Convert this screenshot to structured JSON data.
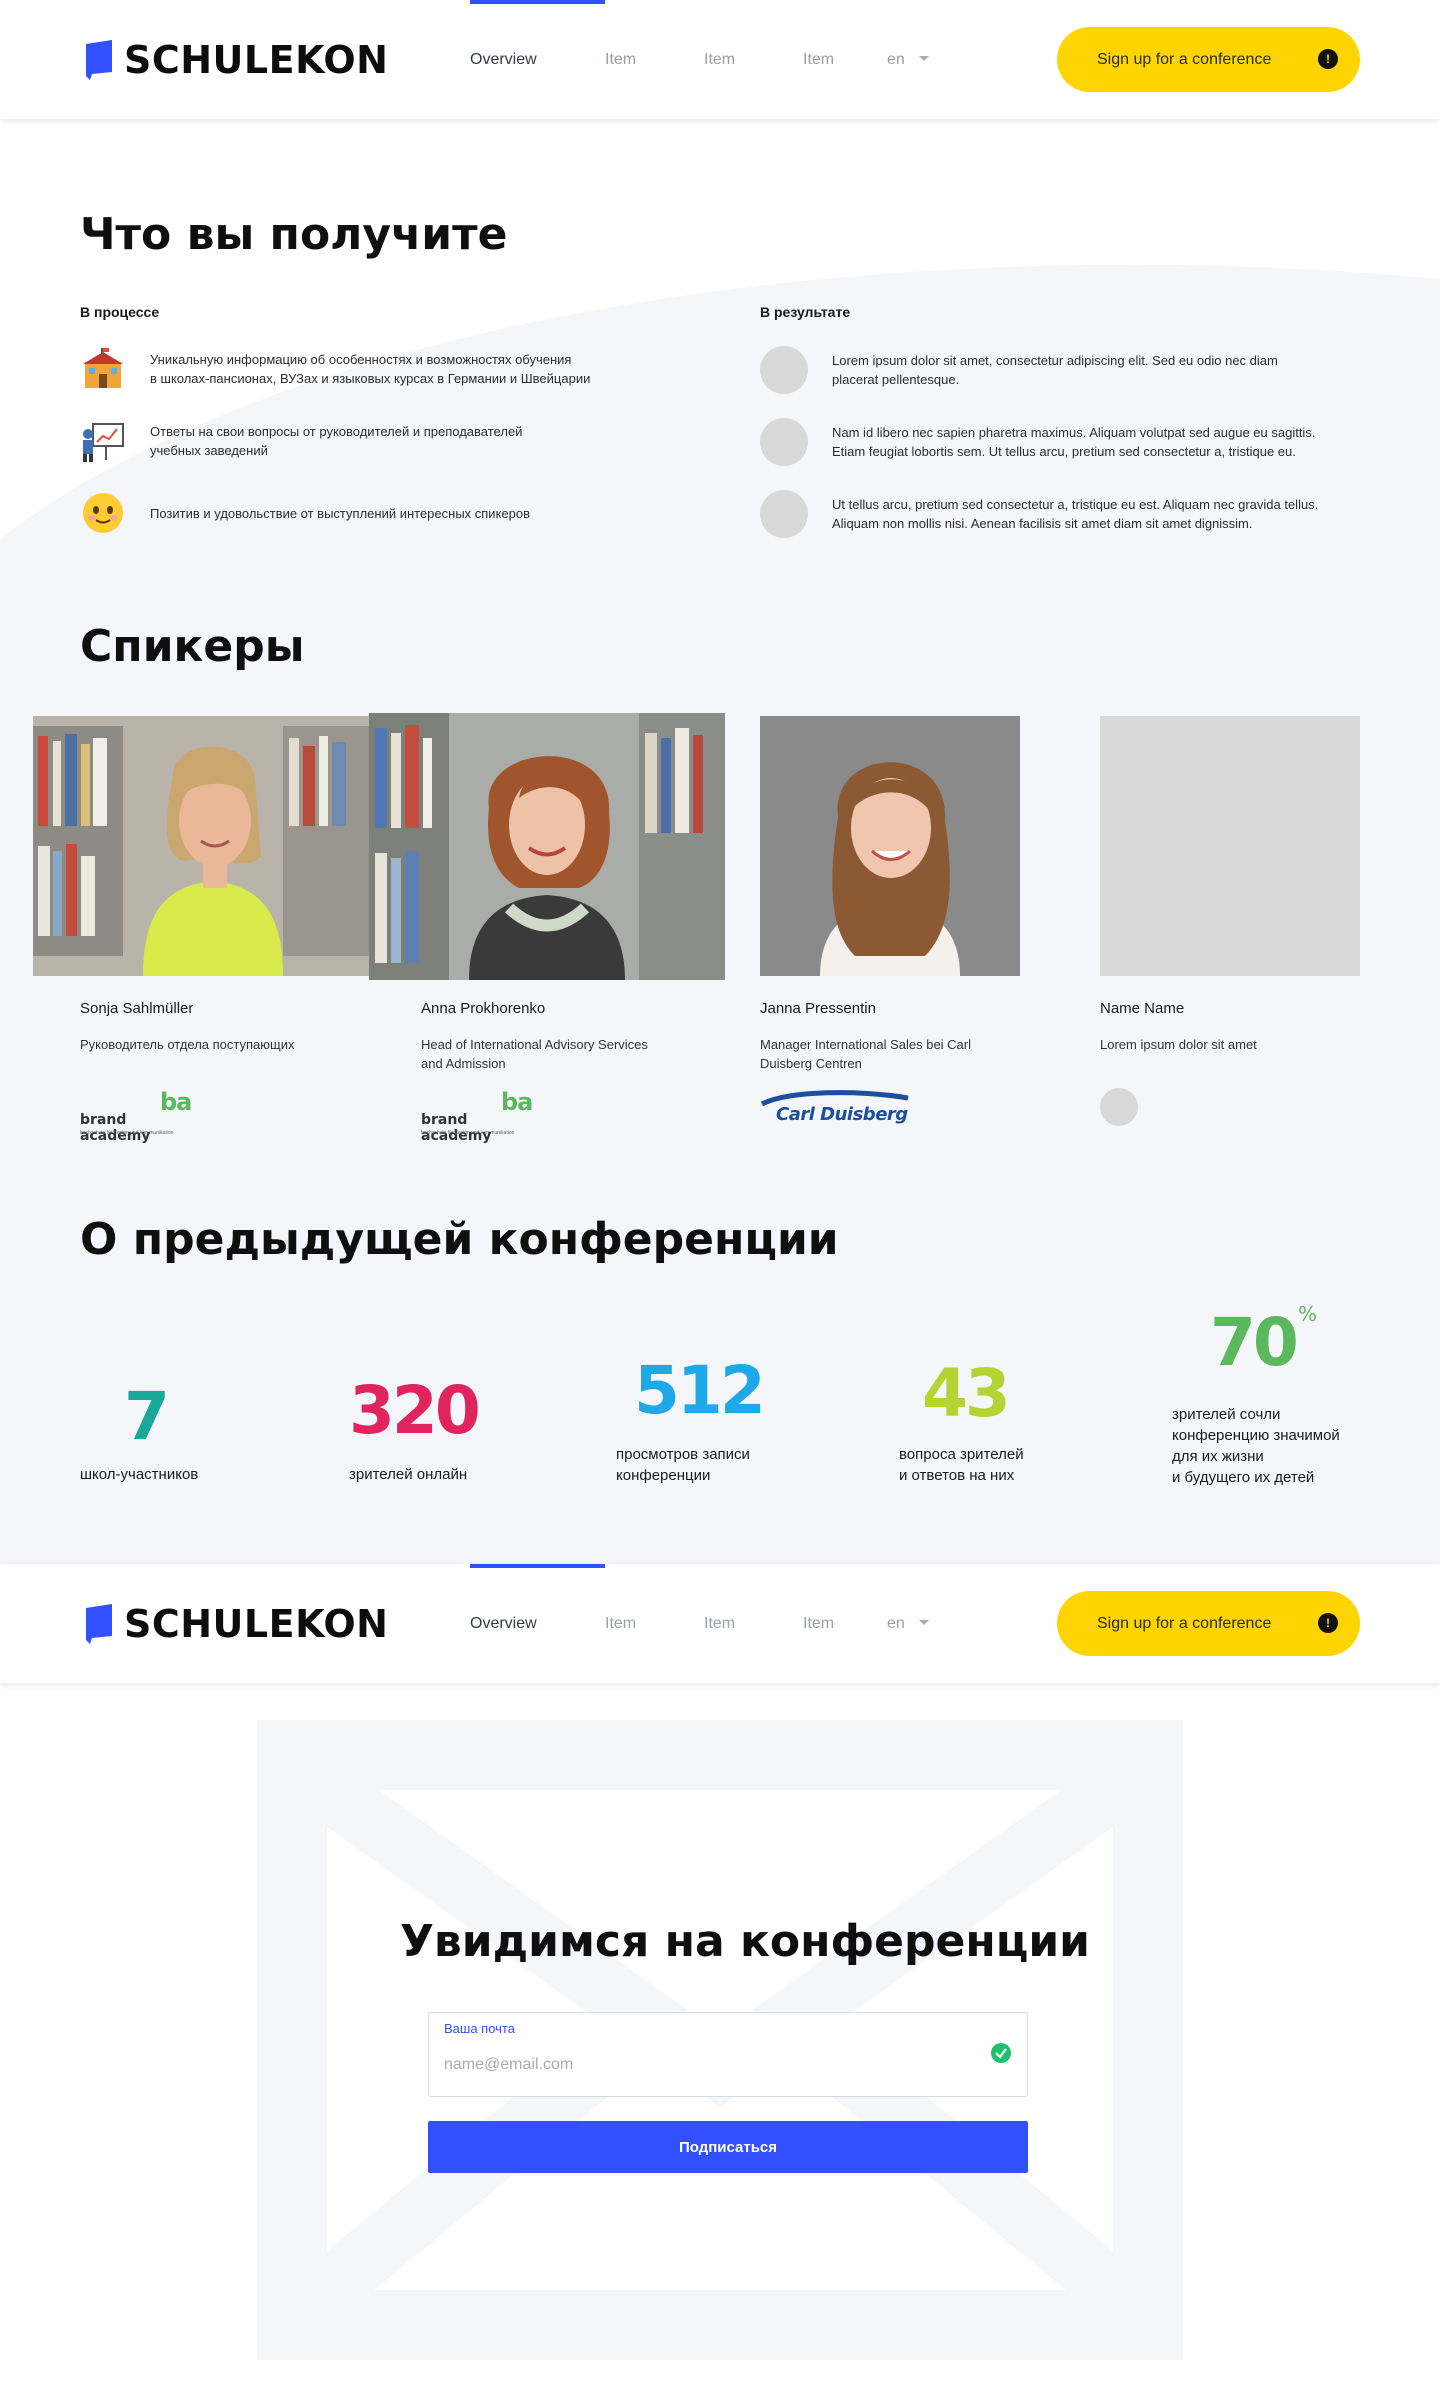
{
  "brand": {
    "name": "SCHULEKON"
  },
  "nav": {
    "items": [
      {
        "label": "Overview",
        "active": true
      },
      {
        "label": "Item",
        "active": false
      },
      {
        "label": "Item",
        "active": false
      },
      {
        "label": "Item",
        "active": false
      }
    ],
    "language": "en",
    "cta_label": "Sign up for a conference",
    "cta_icon": "!"
  },
  "benefits": {
    "title": "Что вы получите",
    "process": {
      "heading": "В процессе",
      "items": [
        {
          "icon": "school-building-icon",
          "text_line1": "Уникальную информацию об особенностях и возможностях обучения",
          "text_line2": "в школах-пансионах, ВУЗах и языковых курсах в Германии и Швейцарии"
        },
        {
          "icon": "presentation-icon",
          "text_line1": "Ответы на свои вопросы от руководителей и преподавателей",
          "text_line2": "учебных заведений"
        },
        {
          "icon": "smiley-icon",
          "text_line1": "Позитив и удовольствие от выступлений интересных спикеров",
          "text_line2": ""
        }
      ]
    },
    "result": {
      "heading": "В результате",
      "items": [
        {
          "text_line1": "Lorem ipsum dolor sit amet, consectetur adipiscing elit. Sed eu odio nec diam",
          "text_line2": "placerat pellentesque."
        },
        {
          "text_line1": "Nam id libero nec sapien pharetra maximus. Aliquam volutpat sed augue eu sagittis.",
          "text_line2": "Etiam feugiat lobortis sem. Ut tellus arcu, pretium sed consectetur a, tristique eu."
        },
        {
          "text_line1": "Ut tellus arcu, pretium sed consectetur a, tristique eu est. Aliquam nec gravida tellus.",
          "text_line2": "Aliquam non mollis nisi. Aenean facilisis sit amet diam sit amet dignissim."
        }
      ]
    }
  },
  "speakers": {
    "title": "Спикеры",
    "items": [
      {
        "name": "Sonja Sahlmüller",
        "role_line1": "Руководитель отдела поступающих",
        "role_line2": "",
        "logo": "brand academy",
        "logo_sub": "hochschule für design und kommunikation"
      },
      {
        "name": "Anna Prokhorenko",
        "role_line1": "Head of International Advisory Services",
        "role_line2": "and Admission",
        "logo": "brand academy",
        "logo_sub": "hochschule für design und kommunikation"
      },
      {
        "name": "Janna Pressentin",
        "role_line1": "Manager International Sales bei Carl",
        "role_line2": "Duisberg Centren",
        "logo": "Carl Duisberg",
        "logo_sub": ""
      },
      {
        "name": "Name Name",
        "role_line1": "Lorem ipsum dolor sit amet",
        "role_line2": "",
        "logo": "",
        "logo_sub": ""
      }
    ]
  },
  "stats": {
    "title": "О предыдущей конференции",
    "items": [
      {
        "value": "7",
        "label_line1": "школ-участников",
        "label_line2": "",
        "label_line3": "",
        "label_line4": "",
        "color": "#1aa89a"
      },
      {
        "value": "320",
        "label_line1": "зрителей онлайн",
        "label_line2": "",
        "label_line3": "",
        "label_line4": "",
        "color": "#e0245e"
      },
      {
        "value": "512",
        "label_line1": "просмотров записи",
        "label_line2": "конференции",
        "label_line3": "",
        "label_line4": "",
        "color": "#1fa8e8"
      },
      {
        "value": "43",
        "label_line1": "вопроса зрителей",
        "label_line2": "и ответов на них",
        "label_line3": "",
        "label_line4": "",
        "color": "#b4d433"
      },
      {
        "value": "70",
        "suffix": "%",
        "label_line1": "зрителей сочли",
        "label_line2": "конференцию значимой",
        "label_line3": "для их жизни",
        "label_line4": "и будущего их детей",
        "color": "#5cb85c"
      }
    ]
  },
  "subscribe": {
    "title": "Увидимся на конференции",
    "email_label": "Ваша почта",
    "email_placeholder": "name@email.com",
    "submit_label": "Подписаться"
  },
  "colors": {
    "accent": "#3350ff",
    "cta": "#ffd400",
    "section_bg": "#f5f6fa",
    "success": "#1cc26a"
  }
}
